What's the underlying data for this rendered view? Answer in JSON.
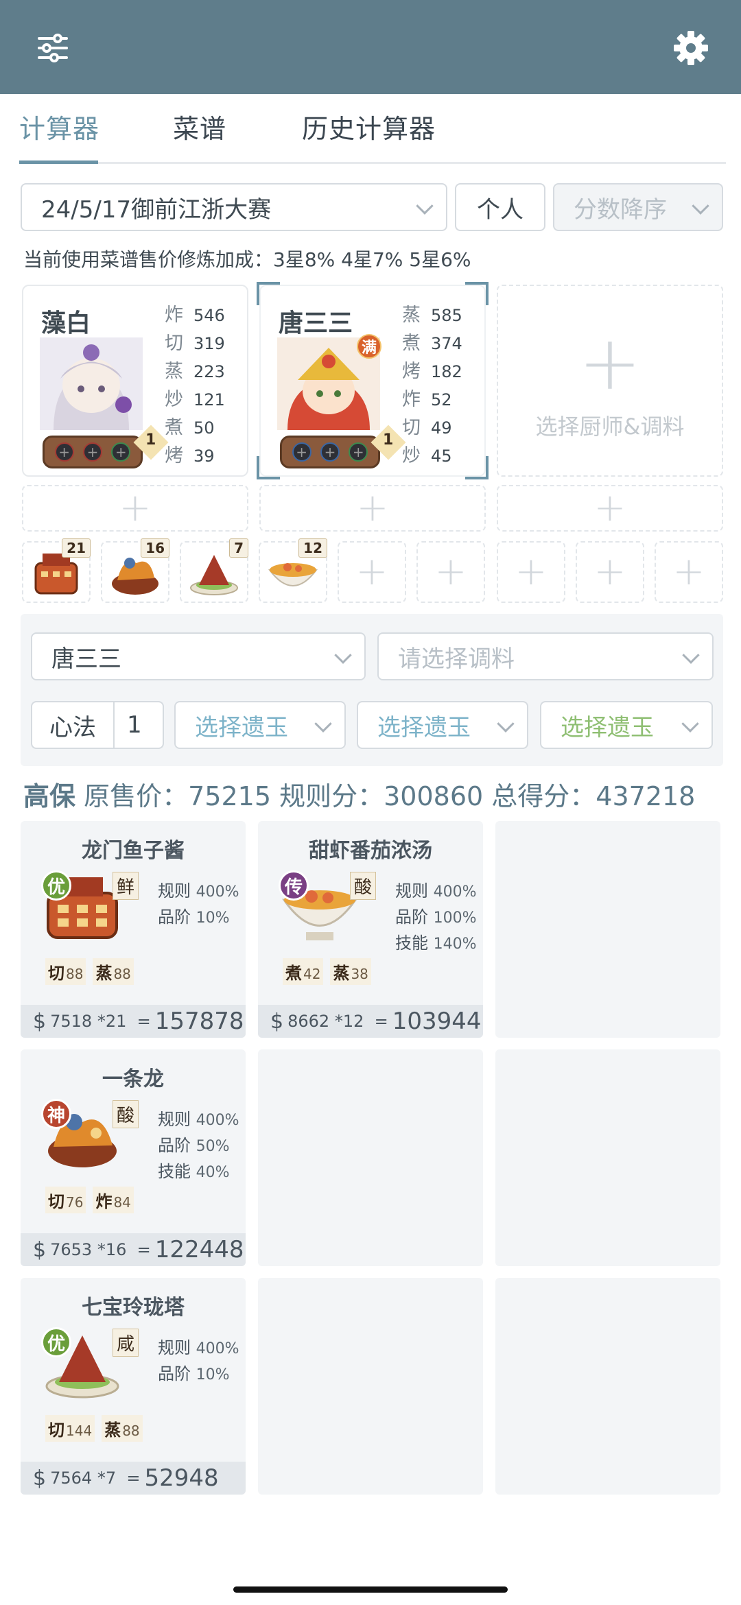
{
  "topbar": {
    "filter_icon": "sliders-icon",
    "settings_icon": "gear-icon",
    "color": "#5f7d8b"
  },
  "tabs": [
    {
      "label": "计算器",
      "active": true
    },
    {
      "label": "菜谱",
      "active": false
    },
    {
      "label": "历史计算器",
      "active": false
    }
  ],
  "filters": {
    "contest": "24/5/17御前江浙大赛",
    "scope": "个人",
    "sort": "分数降序"
  },
  "info_line": "当前使用菜谱售价修炼加成：3星8% 4星7% 5星6%",
  "chefs": [
    {
      "name": "藻白",
      "level": "1",
      "skills": [
        {
          "name": "炸",
          "value": "546"
        },
        {
          "name": "切",
          "value": "319"
        },
        {
          "name": "蒸",
          "value": "223"
        },
        {
          "name": "炒",
          "value": "121"
        },
        {
          "name": "煮",
          "value": "50"
        },
        {
          "name": "烤",
          "value": "39"
        }
      ]
    },
    {
      "name": "唐三三",
      "level": "1",
      "badge": "满",
      "skills": [
        {
          "name": "蒸",
          "value": "585"
        },
        {
          "name": "煮",
          "value": "374"
        },
        {
          "name": "烤",
          "value": "182"
        },
        {
          "name": "炸",
          "value": "52"
        },
        {
          "name": "切",
          "value": "49"
        },
        {
          "name": "炒",
          "value": "45"
        }
      ]
    }
  ],
  "add_chef_label": "选择厨师&调料",
  "mini_slots": [
    {
      "count": "21",
      "icon": "dragon-gate-caviar-icon"
    },
    {
      "count": "16",
      "icon": "dragon-dish-icon"
    },
    {
      "count": "7",
      "icon": "pagoda-dish-icon"
    },
    {
      "count": "12",
      "icon": "shrimp-soup-icon"
    }
  ],
  "panel": {
    "chef_select": "唐三三",
    "seasoning_placeholder": "请选择调料",
    "xinfa_label": "心法",
    "xinfa_value": "1",
    "jade_placeholder_1": "选择遗玉",
    "jade_placeholder_2": "选择遗玉",
    "jade_placeholder_3": "选择遗玉",
    "jade_colors": [
      "#7db3c9",
      "#7db3c9",
      "#8fbf73"
    ]
  },
  "summary": {
    "grade": "高保",
    "original_price_label": "原售价：",
    "original_price": "75215",
    "rule_score_label": "规则分：",
    "rule_score": "300860",
    "total_label": "总得分：",
    "total": "437218"
  },
  "recipes": [
    {
      "title": "龙门鱼子酱",
      "rarity": "优",
      "rarity_color": "#6a9e3a",
      "flavor": "鲜",
      "bonuses": [
        {
          "label": "规则",
          "value": "400%"
        },
        {
          "label": "品阶",
          "value": "10%"
        }
      ],
      "reqs": [
        {
          "skill": "切",
          "value": "88"
        },
        {
          "skill": "蒸",
          "value": "88"
        }
      ],
      "price": "7518",
      "mult": "*21",
      "total": "157878"
    },
    {
      "title": "甜虾番茄浓汤",
      "rarity": "传",
      "rarity_color": "#7a3f84",
      "flavor": "酸",
      "bonuses": [
        {
          "label": "规则",
          "value": "400%"
        },
        {
          "label": "品阶",
          "value": "100%"
        },
        {
          "label": "技能",
          "value": "140%"
        }
      ],
      "reqs": [
        {
          "skill": "煮",
          "value": "42"
        },
        {
          "skill": "蒸",
          "value": "38"
        }
      ],
      "price": "8662",
      "mult": "*12",
      "total": "103944"
    },
    {
      "title": "一条龙",
      "rarity": "神",
      "rarity_color": "#b8452f",
      "flavor": "酸",
      "bonuses": [
        {
          "label": "规则",
          "value": "400%"
        },
        {
          "label": "品阶",
          "value": "50%"
        },
        {
          "label": "技能",
          "value": "40%"
        }
      ],
      "reqs": [
        {
          "skill": "切",
          "value": "76"
        },
        {
          "skill": "炸",
          "value": "84"
        }
      ],
      "price": "7653",
      "mult": "*16",
      "total": "122448"
    },
    {
      "title": "七宝玲珑塔",
      "rarity": "优",
      "rarity_color": "#6a9e3a",
      "flavor": "咸",
      "bonuses": [
        {
          "label": "规则",
          "value": "400%"
        },
        {
          "label": "品阶",
          "value": "10%"
        }
      ],
      "reqs": [
        {
          "skill": "切",
          "value": "144"
        },
        {
          "skill": "蒸",
          "value": "88"
        }
      ],
      "price": "7564",
      "mult": "*7",
      "total": "52948"
    }
  ],
  "currency_symbol": "$",
  "equals": "="
}
